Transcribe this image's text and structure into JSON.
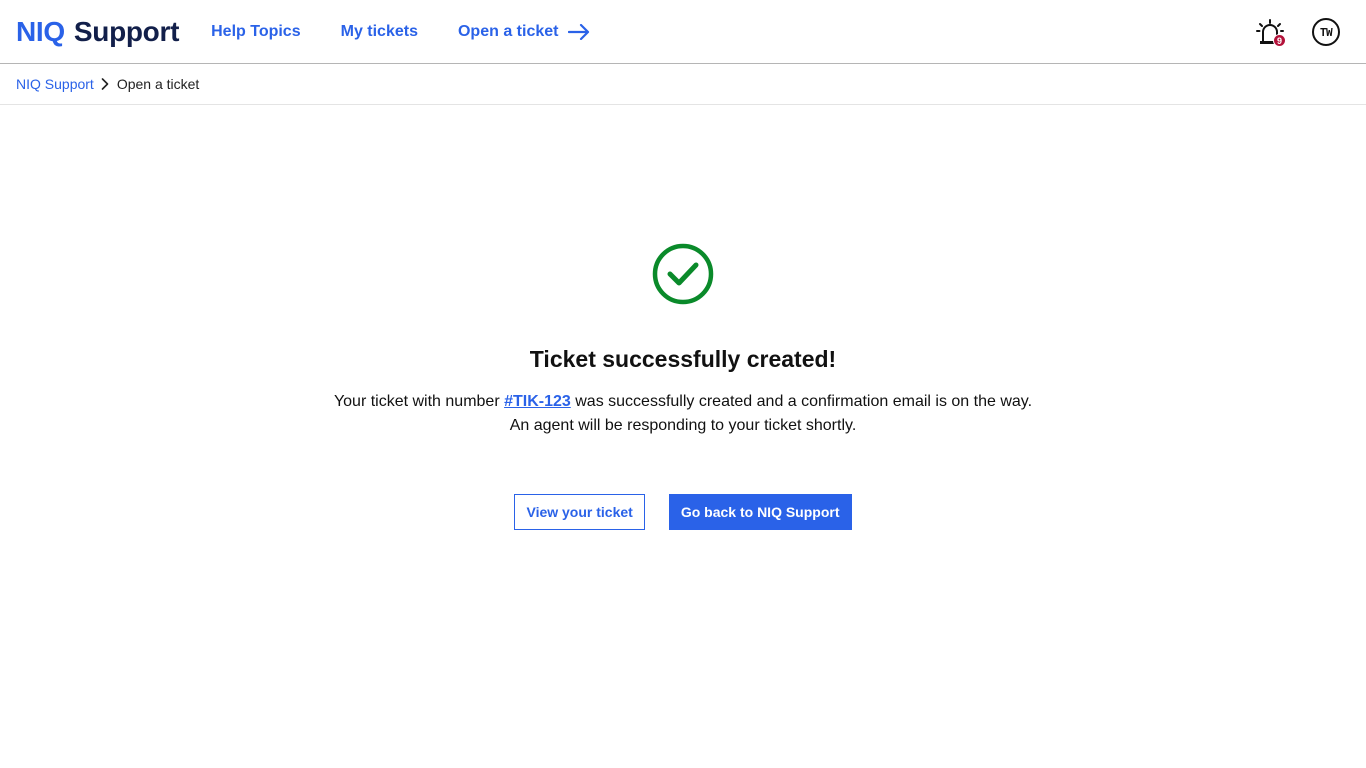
{
  "header": {
    "logo_brand": "NIQ",
    "logo_product": "Support",
    "nav": {
      "help_topics": "Help Topics",
      "my_tickets": "My tickets",
      "open_ticket": "Open a ticket"
    },
    "notification_count": "9",
    "avatar_initials": "TW"
  },
  "breadcrumb": {
    "root": "NIQ Support",
    "current": "Open a ticket"
  },
  "confirmation": {
    "title": "Ticket successfully created!",
    "msg_prefix": "Your ticket with number ",
    "ticket_number": "#TIK-123",
    "msg_suffix": " was successfully created and a confirmation email is on the way.",
    "msg_line2": "An agent will be responding to your ticket shortly.",
    "view_button": "View your ticket",
    "back_button": "Go back to NIQ Support"
  },
  "colors": {
    "accent": "#2a62e8",
    "success": "#0a8a2a",
    "badge": "#b3123a",
    "logo_dark": "#121f4a"
  }
}
